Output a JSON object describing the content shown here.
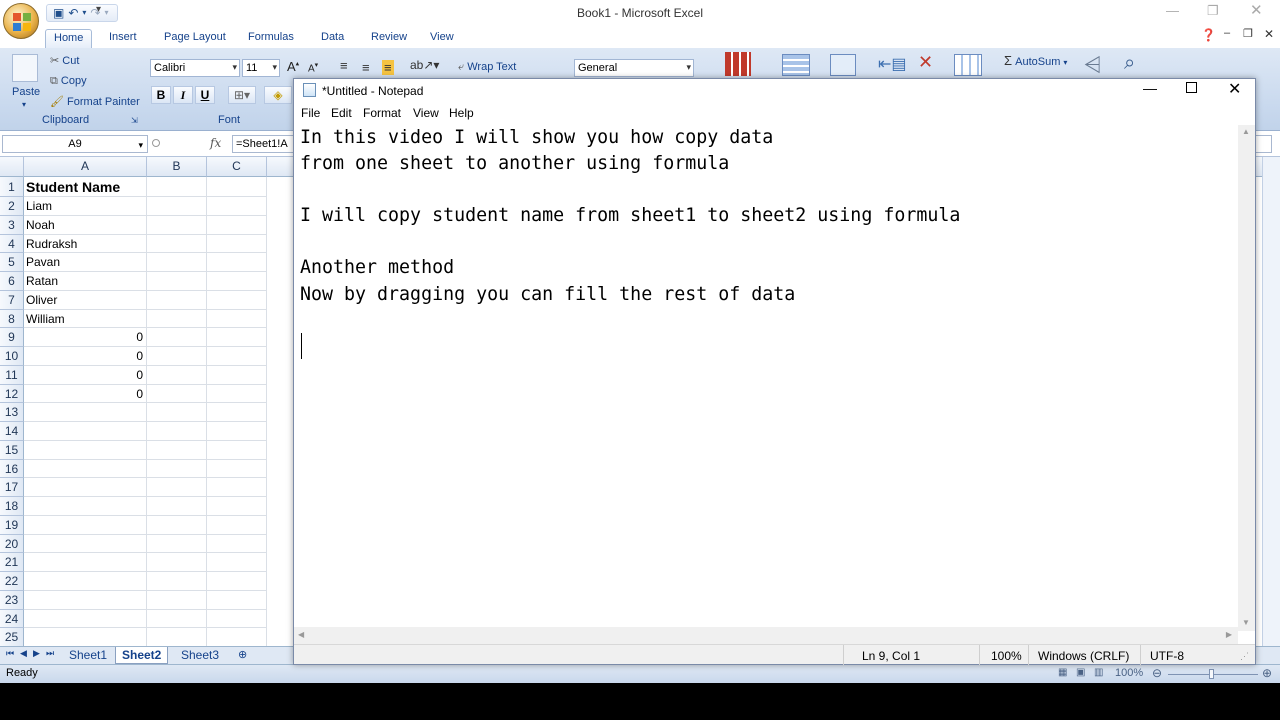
{
  "excel": {
    "title": "Book1 - Microsoft Excel",
    "tabs": [
      "Home",
      "Insert",
      "Page Layout",
      "Formulas",
      "Data",
      "Review",
      "View"
    ],
    "ribbon": {
      "paste": "Paste",
      "cut": "Cut",
      "copy": "Copy",
      "format_painter": "Format Painter",
      "clipboard_label": "Clipboard",
      "font_name": "Calibri",
      "font_size": "11",
      "font_label": "Font",
      "bold": "B",
      "italic": "I",
      "underline": "U",
      "wrap_text": "Wrap Text",
      "number_format": "General",
      "autosum": "AutoSum"
    },
    "name_box": "A9",
    "formula": "=Sheet1!A",
    "columns": [
      "A",
      "B",
      "C"
    ],
    "rows": [
      {
        "num": "1",
        "a": "Student Name"
      },
      {
        "num": "2",
        "a": "Liam"
      },
      {
        "num": "3",
        "a": "Noah"
      },
      {
        "num": "4",
        "a": "Rudraksh"
      },
      {
        "num": "5",
        "a": "Pavan"
      },
      {
        "num": "6",
        "a": "Ratan"
      },
      {
        "num": "7",
        "a": "Oliver"
      },
      {
        "num": "8",
        "a": "William"
      },
      {
        "num": "9",
        "a": "0"
      },
      {
        "num": "10",
        "a": "0"
      },
      {
        "num": "11",
        "a": "0"
      },
      {
        "num": "12",
        "a": "0"
      },
      {
        "num": "13",
        "a": ""
      },
      {
        "num": "14",
        "a": ""
      },
      {
        "num": "15",
        "a": ""
      },
      {
        "num": "16",
        "a": ""
      },
      {
        "num": "17",
        "a": ""
      },
      {
        "num": "18",
        "a": ""
      },
      {
        "num": "19",
        "a": ""
      },
      {
        "num": "20",
        "a": ""
      },
      {
        "num": "21",
        "a": ""
      },
      {
        "num": "22",
        "a": ""
      },
      {
        "num": "23",
        "a": ""
      },
      {
        "num": "24",
        "a": ""
      },
      {
        "num": "25",
        "a": ""
      }
    ],
    "sheets": [
      "Sheet1",
      "Sheet2",
      "Sheet3"
    ],
    "active_sheet": "Sheet2",
    "status": "Ready",
    "zoom": "100%"
  },
  "notepad": {
    "title": "*Untitled - Notepad",
    "menu": [
      "File",
      "Edit",
      "Format",
      "View",
      "Help"
    ],
    "lines": [
      "In this video I will show you how copy data",
      "from one sheet to another using formula",
      "",
      "I will copy student name from sheet1 to sheet2 using formula",
      "",
      "Another method",
      "Now by dragging you can fill the rest of data",
      "",
      ""
    ],
    "status": {
      "position": "Ln 9, Col 1",
      "zoom": "100%",
      "line_endings": "Windows (CRLF)",
      "encoding": "UTF-8"
    }
  }
}
